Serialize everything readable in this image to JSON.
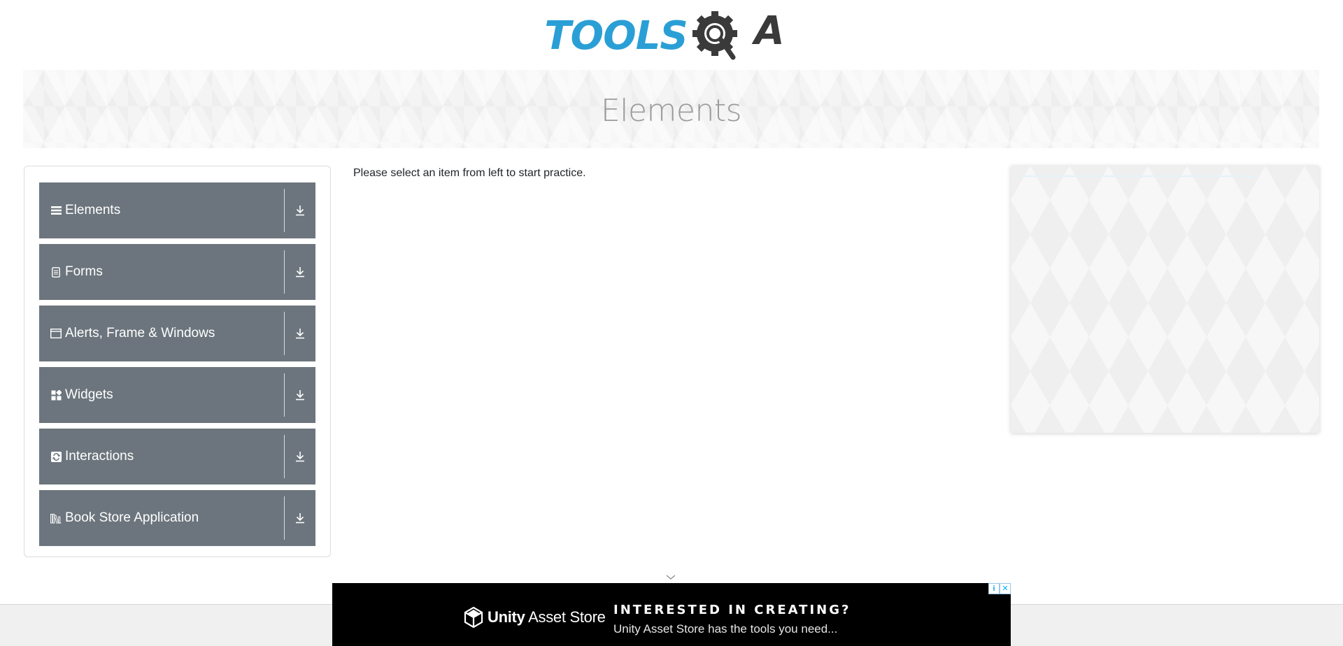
{
  "header": {
    "logo_text_left": "TOOLS",
    "logo_text_right": "QA",
    "brand_color": "#2a9fd6",
    "brand_dark": "#3a3a3a"
  },
  "banner": {
    "title": "Elements"
  },
  "nav": {
    "groups": [
      {
        "label": "Elements",
        "icon": "list-icon"
      },
      {
        "label": "Forms",
        "icon": "document-icon"
      },
      {
        "label": "Alerts, Frame & Windows",
        "icon": "window-icon"
      },
      {
        "label": "Widgets",
        "icon": "widgets-icon"
      },
      {
        "label": "Interactions",
        "icon": "interactions-icon"
      },
      {
        "label": "Book Store Application",
        "icon": "books-icon"
      }
    ],
    "group_color": "#6c757d"
  },
  "main": {
    "message": "Please select an item from left to start practice."
  },
  "bottom_ad": {
    "brand_bold": "Unity",
    "brand_rest": " Asset Store",
    "headline": "INTERESTED IN CREATING?",
    "subline": "Unity Asset Store has the tools you need...",
    "info_label": "i",
    "close_label": "✕"
  }
}
